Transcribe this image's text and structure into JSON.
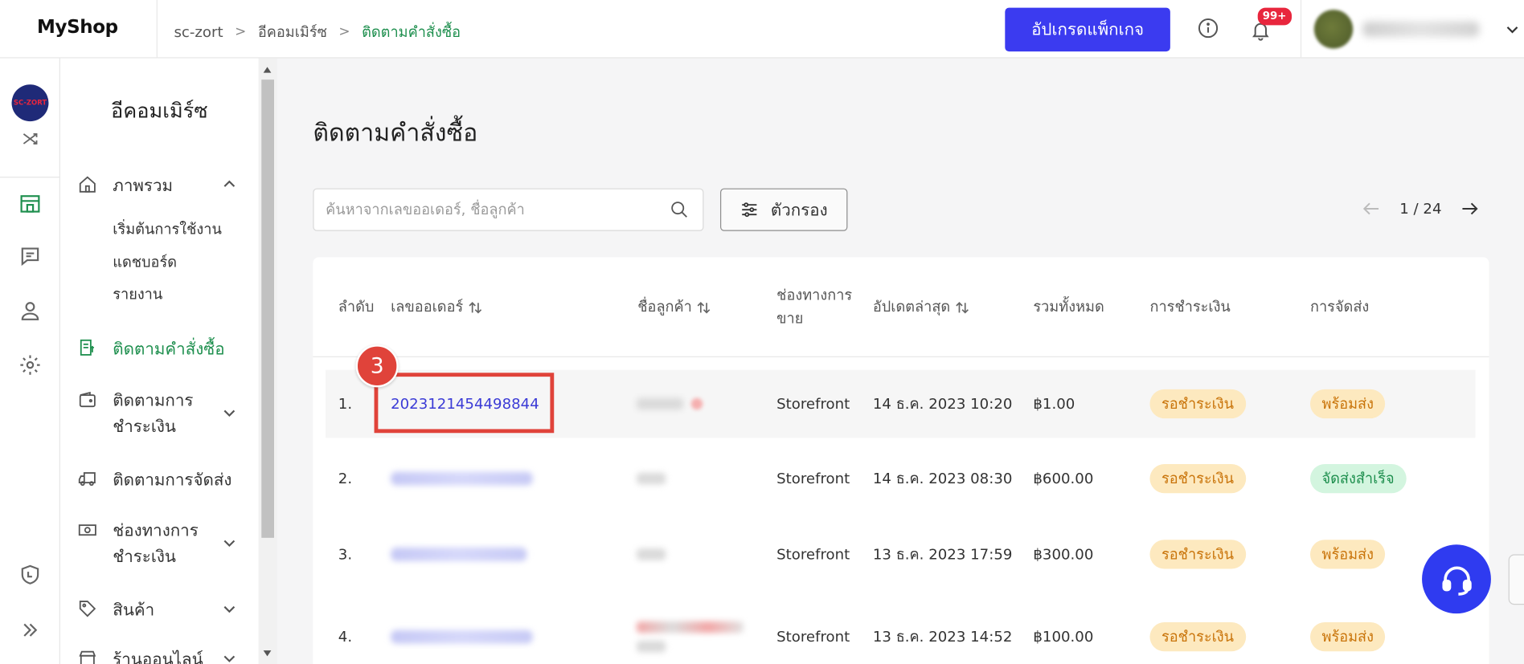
{
  "app": {
    "brand": "MyShop"
  },
  "breadcrumb": [
    "sc-zort",
    "อีคอมเมิร์ซ",
    "ติดตามคำสั่งซื้อ"
  ],
  "header": {
    "upgrade_label": "อัปเกรดแพ็กเกจ",
    "notification_count": "99+"
  },
  "rail": {
    "logo_text": "SC-ZORT"
  },
  "sidebar": {
    "title": "อีคอมเมิร์ซ",
    "items": [
      {
        "label": "ภาพรวม",
        "icon": "home-icon",
        "expanded": true
      },
      {
        "label": "ติดตามคำสั่งซื้อ",
        "icon": "order-list-icon",
        "active": true
      },
      {
        "label": "ติดตามการ ชำระเงิน",
        "icon": "wallet-icon"
      },
      {
        "label": "ติดตามการจัดส่ง",
        "icon": "truck-icon"
      },
      {
        "label": "ช่องทางการ ชำระเงิน",
        "icon": "cash-icon"
      },
      {
        "label": "สินค้า",
        "icon": "tag-icon"
      },
      {
        "label": "ร้านออนไลน์",
        "icon": "store-icon"
      }
    ],
    "subitems": [
      "เริ่มต้นการใช้งาน",
      "แดชบอร์ด",
      "รายงาน"
    ]
  },
  "page": {
    "title": "ติดตามคำสั่งซื้อ",
    "search_placeholder": "ค้นหาจากเลขออเดอร์, ชื่อลูกค้า",
    "filter_label": "ตัวกรอง",
    "pager": "1 / 24"
  },
  "table": {
    "headers": {
      "index": "ลำดับ",
      "order_no": "เลขออเดอร์",
      "customer": "ชื่อลูกค้า",
      "channel": "ช่องทางการ ขาย",
      "updated": "อัปเดตล่าสุด",
      "total": "รวมทั้งหมด",
      "payment": "การชำระเงิน",
      "shipping": "การจัดส่ง"
    },
    "rows": [
      {
        "index": "1.",
        "order_no": "2023121454498844",
        "channel": "Storefront",
        "updated": "14 ธ.ค. 2023 10:20",
        "total": "฿1.00",
        "payment": "รอชำระเงิน",
        "shipping": "พร้อมส่ง"
      },
      {
        "index": "2.",
        "order_no": "",
        "channel": "Storefront",
        "updated": "14 ธ.ค. 2023 08:30",
        "total": "฿600.00",
        "payment": "รอชำระเงิน",
        "shipping": "จัดส่งสำเร็จ"
      },
      {
        "index": "3.",
        "order_no": "",
        "channel": "Storefront",
        "updated": "13 ธ.ค. 2023 17:59",
        "total": "฿300.00",
        "payment": "รอชำระเงิน",
        "shipping": "พร้อมส่ง"
      },
      {
        "index": "4.",
        "order_no": "",
        "channel": "Storefront",
        "updated": "13 ธ.ค. 2023 14:52",
        "total": "฿100.00",
        "payment": "รอชำระเงิน",
        "shipping": "พร้อมส่ง"
      }
    ]
  },
  "annotation": {
    "step": "3"
  },
  "colors": {
    "primary": "#3b3bf0",
    "active_green": "#1e8f4e",
    "highlight_red": "#e0433a",
    "pending_bg": "#fde9bf",
    "success_bg": "#d3f5df"
  }
}
